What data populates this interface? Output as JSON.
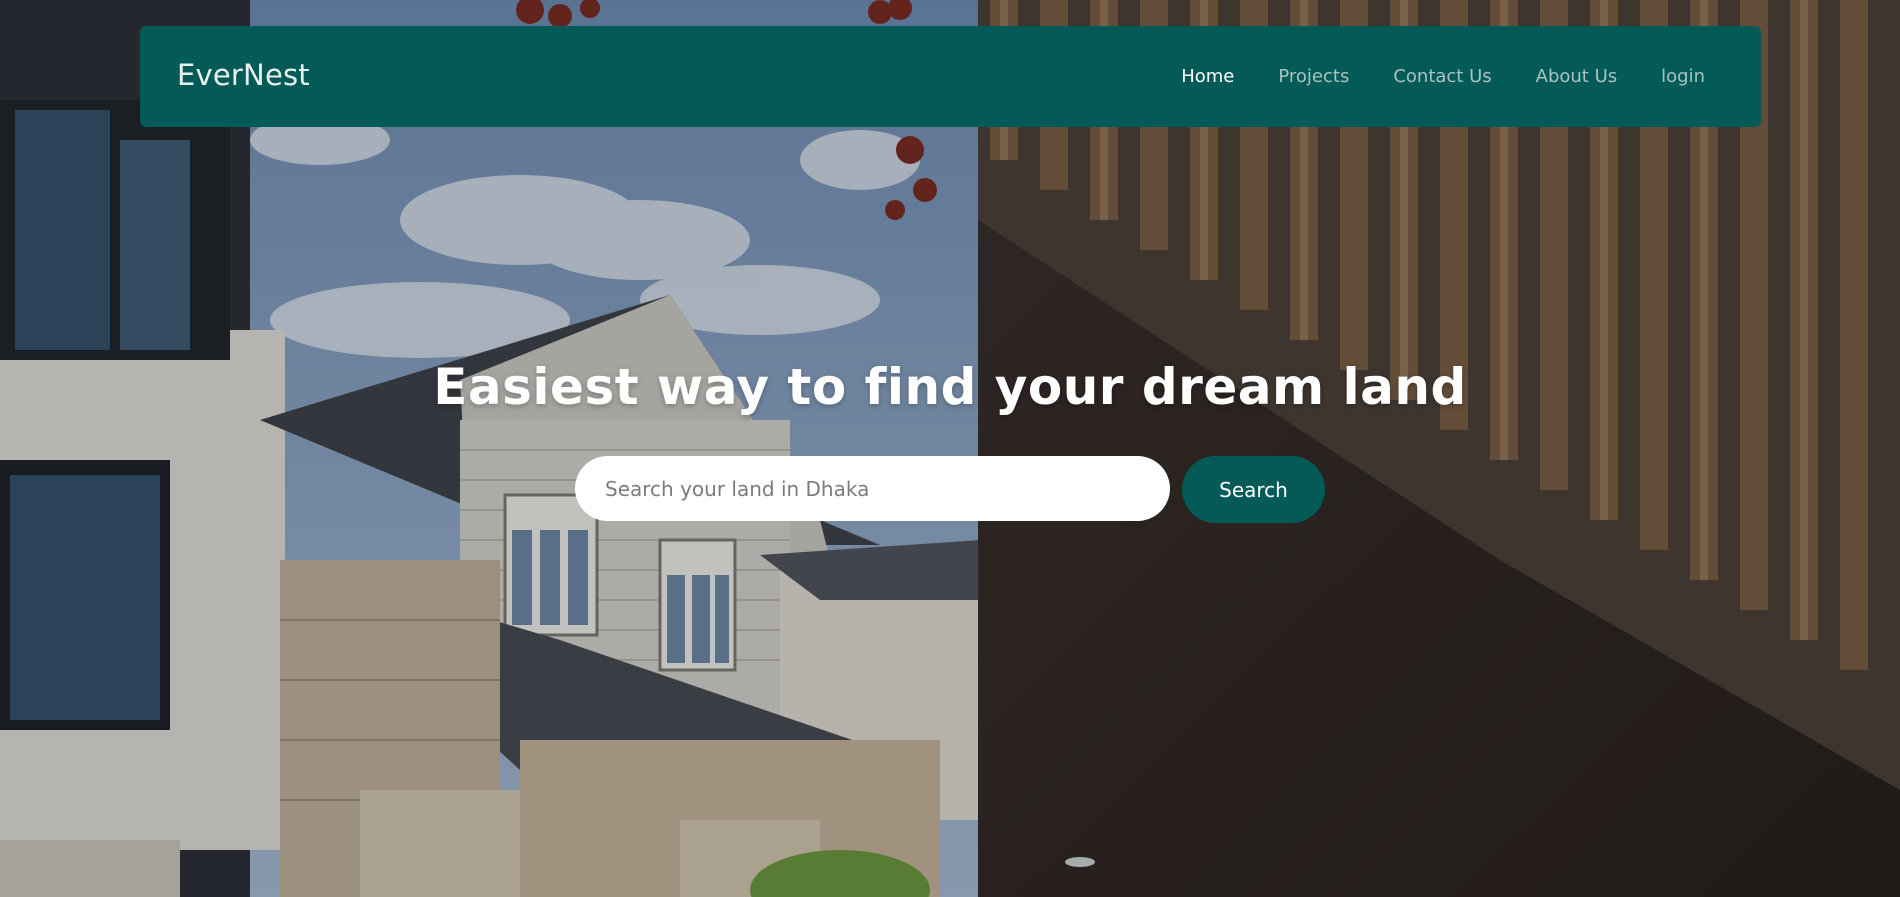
{
  "brand": {
    "name": "EverNest"
  },
  "nav": {
    "items": [
      {
        "label": "Home",
        "active": true
      },
      {
        "label": "Projects",
        "active": false
      },
      {
        "label": "Contact Us",
        "active": false
      },
      {
        "label": "About Us",
        "active": false
      },
      {
        "label": "login",
        "active": false
      }
    ]
  },
  "hero": {
    "title": "Easiest way to find your dream land",
    "search": {
      "placeholder": "Search your land in Dhaka",
      "value": "",
      "button_label": "Search"
    }
  },
  "colors": {
    "primary": "#045a57",
    "nav_active": "#ffffff",
    "nav_inactive": "#a9c3c0",
    "input_bg": "#ffffff"
  }
}
